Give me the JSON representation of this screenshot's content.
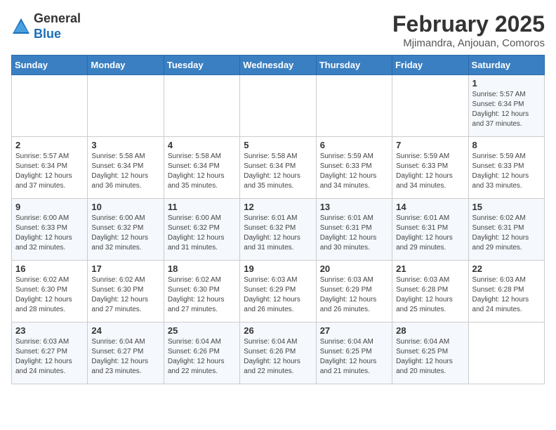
{
  "header": {
    "logo_general": "General",
    "logo_blue": "Blue",
    "month_title": "February 2025",
    "location": "Mjimandra, Anjouan, Comoros"
  },
  "weekdays": [
    "Sunday",
    "Monday",
    "Tuesday",
    "Wednesday",
    "Thursday",
    "Friday",
    "Saturday"
  ],
  "weeks": [
    [
      {
        "day": "",
        "info": ""
      },
      {
        "day": "",
        "info": ""
      },
      {
        "day": "",
        "info": ""
      },
      {
        "day": "",
        "info": ""
      },
      {
        "day": "",
        "info": ""
      },
      {
        "day": "",
        "info": ""
      },
      {
        "day": "1",
        "info": "Sunrise: 5:57 AM\nSunset: 6:34 PM\nDaylight: 12 hours\nand 37 minutes."
      }
    ],
    [
      {
        "day": "2",
        "info": "Sunrise: 5:57 AM\nSunset: 6:34 PM\nDaylight: 12 hours\nand 37 minutes."
      },
      {
        "day": "3",
        "info": "Sunrise: 5:58 AM\nSunset: 6:34 PM\nDaylight: 12 hours\nand 36 minutes."
      },
      {
        "day": "4",
        "info": "Sunrise: 5:58 AM\nSunset: 6:34 PM\nDaylight: 12 hours\nand 35 minutes."
      },
      {
        "day": "5",
        "info": "Sunrise: 5:58 AM\nSunset: 6:34 PM\nDaylight: 12 hours\nand 35 minutes."
      },
      {
        "day": "6",
        "info": "Sunrise: 5:59 AM\nSunset: 6:33 PM\nDaylight: 12 hours\nand 34 minutes."
      },
      {
        "day": "7",
        "info": "Sunrise: 5:59 AM\nSunset: 6:33 PM\nDaylight: 12 hours\nand 34 minutes."
      },
      {
        "day": "8",
        "info": "Sunrise: 5:59 AM\nSunset: 6:33 PM\nDaylight: 12 hours\nand 33 minutes."
      }
    ],
    [
      {
        "day": "9",
        "info": "Sunrise: 6:00 AM\nSunset: 6:33 PM\nDaylight: 12 hours\nand 32 minutes."
      },
      {
        "day": "10",
        "info": "Sunrise: 6:00 AM\nSunset: 6:32 PM\nDaylight: 12 hours\nand 32 minutes."
      },
      {
        "day": "11",
        "info": "Sunrise: 6:00 AM\nSunset: 6:32 PM\nDaylight: 12 hours\nand 31 minutes."
      },
      {
        "day": "12",
        "info": "Sunrise: 6:01 AM\nSunset: 6:32 PM\nDaylight: 12 hours\nand 31 minutes."
      },
      {
        "day": "13",
        "info": "Sunrise: 6:01 AM\nSunset: 6:31 PM\nDaylight: 12 hours\nand 30 minutes."
      },
      {
        "day": "14",
        "info": "Sunrise: 6:01 AM\nSunset: 6:31 PM\nDaylight: 12 hours\nand 29 minutes."
      },
      {
        "day": "15",
        "info": "Sunrise: 6:02 AM\nSunset: 6:31 PM\nDaylight: 12 hours\nand 29 minutes."
      }
    ],
    [
      {
        "day": "16",
        "info": "Sunrise: 6:02 AM\nSunset: 6:30 PM\nDaylight: 12 hours\nand 28 minutes."
      },
      {
        "day": "17",
        "info": "Sunrise: 6:02 AM\nSunset: 6:30 PM\nDaylight: 12 hours\nand 27 minutes."
      },
      {
        "day": "18",
        "info": "Sunrise: 6:02 AM\nSunset: 6:30 PM\nDaylight: 12 hours\nand 27 minutes."
      },
      {
        "day": "19",
        "info": "Sunrise: 6:03 AM\nSunset: 6:29 PM\nDaylight: 12 hours\nand 26 minutes."
      },
      {
        "day": "20",
        "info": "Sunrise: 6:03 AM\nSunset: 6:29 PM\nDaylight: 12 hours\nand 26 minutes."
      },
      {
        "day": "21",
        "info": "Sunrise: 6:03 AM\nSunset: 6:28 PM\nDaylight: 12 hours\nand 25 minutes."
      },
      {
        "day": "22",
        "info": "Sunrise: 6:03 AM\nSunset: 6:28 PM\nDaylight: 12 hours\nand 24 minutes."
      }
    ],
    [
      {
        "day": "23",
        "info": "Sunrise: 6:03 AM\nSunset: 6:27 PM\nDaylight: 12 hours\nand 24 minutes."
      },
      {
        "day": "24",
        "info": "Sunrise: 6:04 AM\nSunset: 6:27 PM\nDaylight: 12 hours\nand 23 minutes."
      },
      {
        "day": "25",
        "info": "Sunrise: 6:04 AM\nSunset: 6:26 PM\nDaylight: 12 hours\nand 22 minutes."
      },
      {
        "day": "26",
        "info": "Sunrise: 6:04 AM\nSunset: 6:26 PM\nDaylight: 12 hours\nand 22 minutes."
      },
      {
        "day": "27",
        "info": "Sunrise: 6:04 AM\nSunset: 6:25 PM\nDaylight: 12 hours\nand 21 minutes."
      },
      {
        "day": "28",
        "info": "Sunrise: 6:04 AM\nSunset: 6:25 PM\nDaylight: 12 hours\nand 20 minutes."
      },
      {
        "day": "",
        "info": ""
      }
    ]
  ]
}
